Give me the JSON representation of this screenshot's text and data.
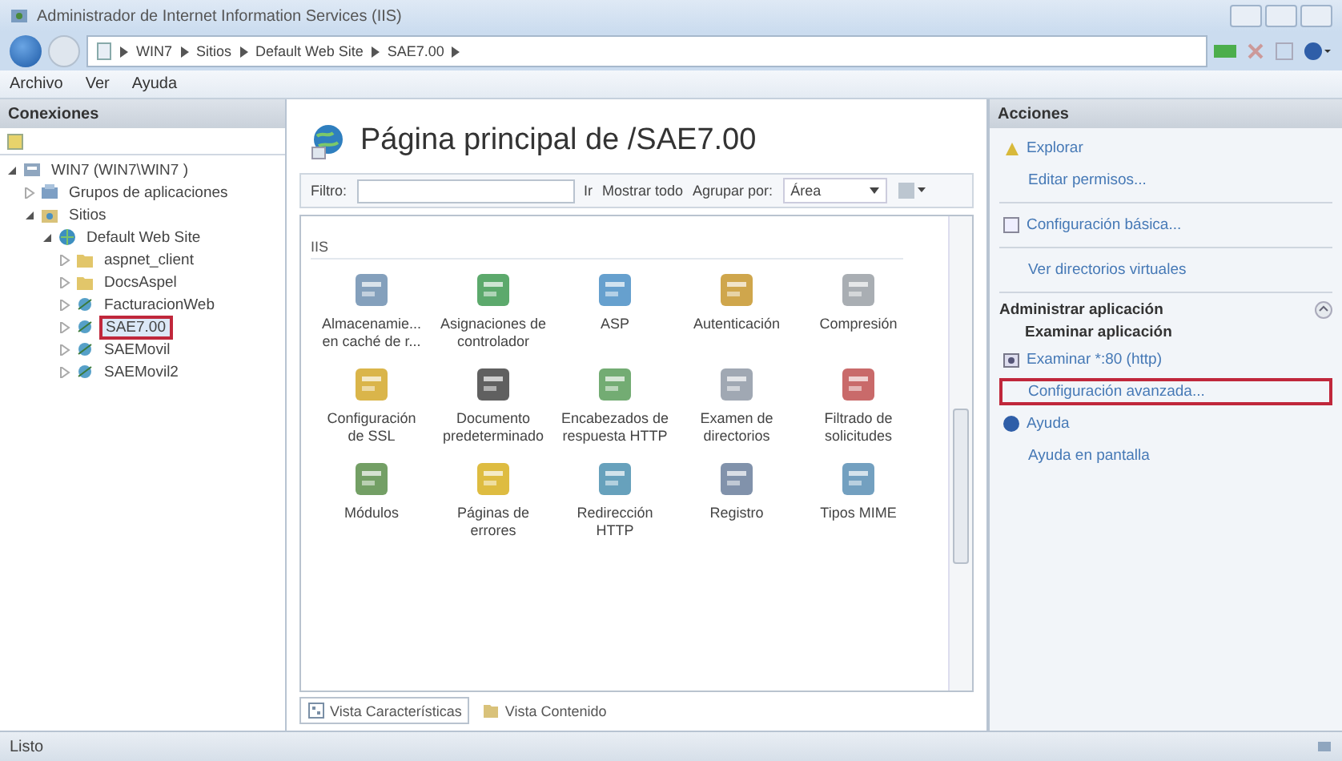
{
  "window": {
    "title": "Administrador de Internet Information Services (IIS)"
  },
  "address_bar": {
    "segments": [
      "WIN7",
      "Sitios",
      "Default Web Site",
      "SAE7.00"
    ]
  },
  "menu": [
    "Archivo",
    "Ver",
    "Ayuda"
  ],
  "connections": {
    "title": "Conexiones",
    "tree": [
      {
        "label": "WIN7 (WIN7\\WIN7 )",
        "kind": "server",
        "expanded": true,
        "selected": false,
        "highlighted": false,
        "children": [
          {
            "label": "Grupos de aplicaciones",
            "kind": "pools",
            "expanded": false,
            "selected": false,
            "highlighted": false
          },
          {
            "label": "Sitios",
            "kind": "sites",
            "expanded": true,
            "selected": false,
            "highlighted": false,
            "children": [
              {
                "label": "Default Web Site",
                "kind": "website",
                "expanded": true,
                "selected": false,
                "highlighted": false,
                "children": [
                  {
                    "label": "aspnet_client",
                    "kind": "folder",
                    "expanded": false,
                    "selected": false,
                    "highlighted": false
                  },
                  {
                    "label": "DocsAspel",
                    "kind": "folder",
                    "expanded": false,
                    "selected": false,
                    "highlighted": false
                  },
                  {
                    "label": "FacturacionWeb",
                    "kind": "app",
                    "expanded": false,
                    "selected": false,
                    "highlighted": false
                  },
                  {
                    "label": "SAE7.00",
                    "kind": "app",
                    "expanded": false,
                    "selected": true,
                    "highlighted": true
                  },
                  {
                    "label": "SAEMovil",
                    "kind": "app",
                    "expanded": false,
                    "selected": false,
                    "highlighted": false
                  },
                  {
                    "label": "SAEMovil2",
                    "kind": "app",
                    "expanded": false,
                    "selected": false,
                    "highlighted": false
                  }
                ]
              }
            ]
          }
        ]
      }
    ]
  },
  "features": {
    "title": "Página principal de /SAE7.00",
    "filter_label": "Filtro:",
    "go": "Ir",
    "show_all": "Mostrar todo",
    "group_by_label": "Agrupar por:",
    "group_by_value": "Área",
    "group": "IIS",
    "items": [
      {
        "label": "Almacenamie... en caché de r..."
      },
      {
        "label": "Asignaciones de controlador"
      },
      {
        "label": "ASP"
      },
      {
        "label": "Autenticación"
      },
      {
        "label": "Compresión"
      },
      {
        "label": "Configuración de SSL"
      },
      {
        "label": "Documento predeterminado"
      },
      {
        "label": "Encabezados de respuesta HTTP"
      },
      {
        "label": "Examen de directorios"
      },
      {
        "label": "Filtrado de solicitudes"
      },
      {
        "label": "Módulos"
      },
      {
        "label": "Páginas de errores"
      },
      {
        "label": "Redirección HTTP"
      },
      {
        "label": "Registro"
      },
      {
        "label": "Tipos MIME"
      }
    ]
  },
  "view_tabs": [
    {
      "label": "Vista Características",
      "selected": true
    },
    {
      "label": "Vista Contenido",
      "selected": false
    }
  ],
  "actions": {
    "title": "Acciones",
    "items": [
      {
        "kind": "link",
        "label": "Explorar",
        "highlighted": false
      },
      {
        "kind": "link",
        "label": "Editar permisos...",
        "highlighted": false
      },
      {
        "kind": "link",
        "label": "Configuración básica...",
        "highlighted": false
      },
      {
        "kind": "link",
        "label": "Ver directorios virtuales",
        "highlighted": false
      },
      {
        "kind": "section",
        "label": "Administrar aplicación",
        "expanded": true
      },
      {
        "kind": "heading",
        "label": "Examinar aplicación"
      },
      {
        "kind": "link",
        "label": "Examinar *:80 (http)",
        "highlighted": false
      },
      {
        "kind": "link",
        "label": "Configuración avanzada...",
        "highlighted": true
      },
      {
        "kind": "link",
        "label": "Ayuda",
        "highlighted": false
      },
      {
        "kind": "link",
        "label": "Ayuda en pantalla",
        "highlighted": false
      }
    ]
  },
  "status_bar": {
    "text": "Listo"
  }
}
